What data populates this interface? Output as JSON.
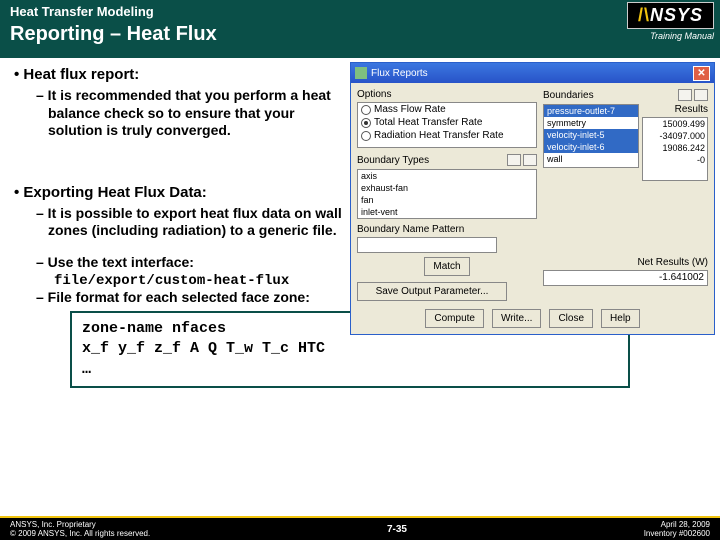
{
  "header": {
    "supertitle": "Heat Transfer Modeling",
    "title": "Reporting – Heat Flux",
    "logo_text": "ANSYS",
    "training": "Training Manual"
  },
  "bullets": {
    "h1": "• Heat flux report:",
    "s1": "– It is recommended that you perform a heat balance check so to ensure that your solution is truly converged.",
    "h2": "• Exporting Heat Flux Data:",
    "s2": "– It is possible to export heat flux data on wall zones (including radiation) to a generic file.",
    "s3": "– Use the text interface:",
    "cmd": "file/export/custom-heat-flux",
    "s4": "– File format for each selected face zone:",
    "code_l1": "zone-name nfaces",
    "code_l2": "x_f  y_f  z_f  A   Q   T_w   T_c   HTC",
    "code_l3": "…"
  },
  "dialog": {
    "title": "Flux Reports",
    "options_label": "Options",
    "opt1": "Mass Flow Rate",
    "opt2": "Total Heat Transfer Rate",
    "opt3": "Radiation Heat Transfer Rate",
    "boundaries_label": "Boundaries",
    "results_label": "Results",
    "boundaries": [
      {
        "label": "pressure-outlet-7",
        "sel": true
      },
      {
        "label": "symmetry",
        "sel": false
      },
      {
        "label": "velocity-inlet-5",
        "sel": true
      },
      {
        "label": "velocity-inlet-6",
        "sel": true
      },
      {
        "label": "wall",
        "sel": false
      }
    ],
    "results": [
      "15009.499",
      "",
      "-34097.000",
      "19086.242",
      "-0"
    ],
    "btypes_label": "Boundary Types",
    "btypes": [
      "axis",
      "exhaust-fan",
      "fan",
      "inlet-vent"
    ],
    "bname_label": "Boundary Name Pattern",
    "match_btn": "Match",
    "save_btn": "Save Output Parameter...",
    "net_label": "Net Results (W)",
    "net_value": "-1.641002",
    "compute": "Compute",
    "write": "Write...",
    "close": "Close",
    "help": "Help"
  },
  "footer": {
    "left1": "ANSYS, Inc. Proprietary",
    "left2": "© 2009 ANSYS, Inc.  All rights reserved.",
    "mid": "7-35",
    "right1": "April 28, 2009",
    "right2": "Inventory #002600"
  }
}
